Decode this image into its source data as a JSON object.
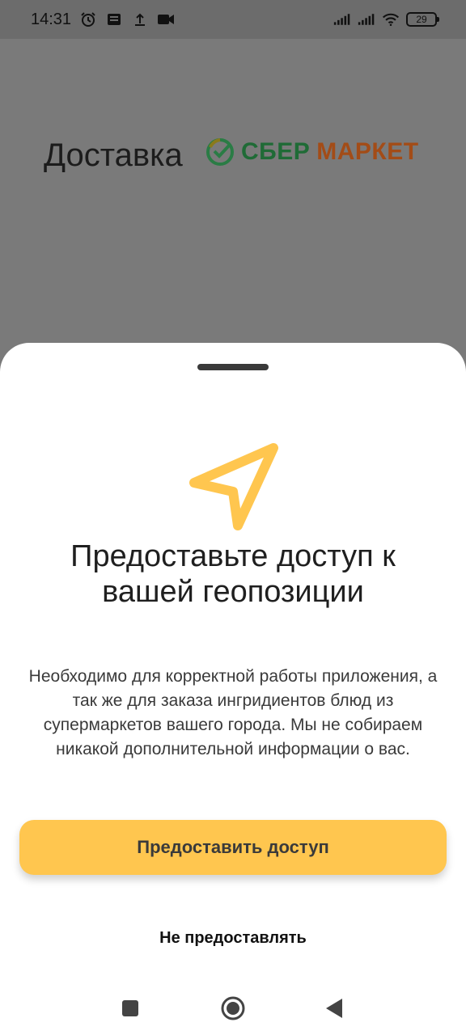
{
  "status_bar": {
    "time": "14:31",
    "battery": "29",
    "icons": [
      "alarm-icon",
      "notification-icon",
      "upload-icon",
      "video-icon",
      "signal-icon",
      "signal-icon",
      "wifi-icon",
      "battery-icon"
    ]
  },
  "background": {
    "delivery_label": "Доставка",
    "brand_part1": "СБЕР",
    "brand_part2": "МАРКЕТ"
  },
  "sheet": {
    "title": "Предоставьте доступ к вашей геопозиции",
    "description": "Необходимо для корректной работы приложения, а так же для заказа ингридиентов блюд из супермаркетов вашего города. Мы не собираем никакой дополнительной информации о вас.",
    "primary_button": "Предоставить доступ",
    "secondary_button": "Не предоставлять",
    "icon": "location-arrow-icon"
  },
  "colors": {
    "accent": "#ffc64f",
    "icon": "#ffc64f",
    "brand_green": "#1f6b36",
    "brand_orange": "#a34c17"
  },
  "nav": {
    "icons": [
      "recents-icon",
      "home-icon",
      "back-icon"
    ]
  }
}
